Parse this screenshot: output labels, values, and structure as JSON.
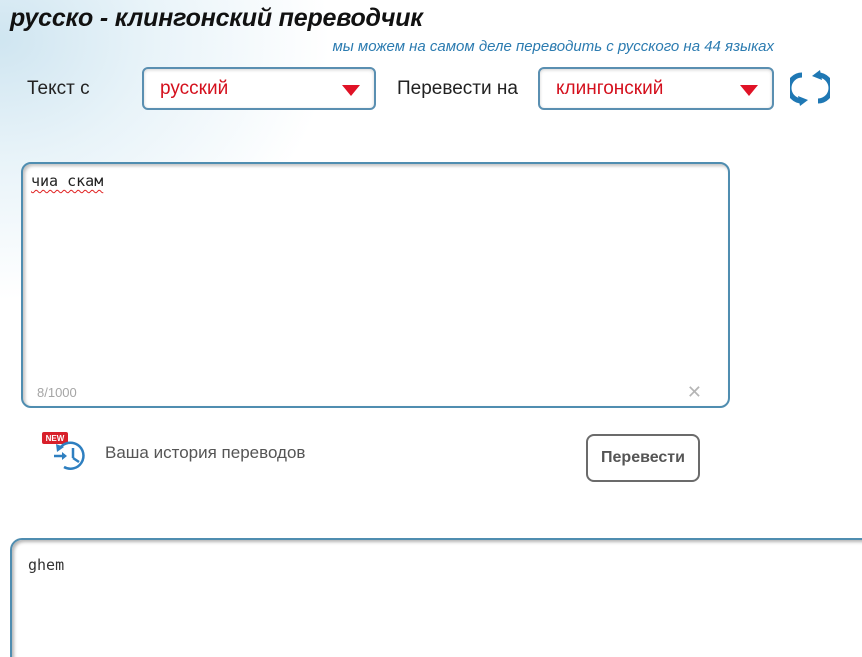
{
  "header": {
    "title": "русско - клингонский переводчик",
    "subtitle": "мы можем на самом деле переводить с русского на 44 языках"
  },
  "language_bar": {
    "from_label": "Текст с",
    "from_value": "русский",
    "to_label": "Перевести на",
    "to_value": "клингонский"
  },
  "input": {
    "text": "чиа скам",
    "counter": "8/1000",
    "clear_glyph": "✕"
  },
  "history": {
    "badge": "NEW",
    "label": "Ваша история переводов"
  },
  "actions": {
    "translate_label": "Перевести"
  },
  "output": {
    "text": "ghem"
  },
  "colors": {
    "accent_red": "#e01226",
    "accent_blue": "#2b7bb0",
    "border_blue": "#4f8db0"
  },
  "icons": [
    "swap-icon",
    "dropdown-arrow-icon",
    "close-icon",
    "history-clock-icon"
  ]
}
